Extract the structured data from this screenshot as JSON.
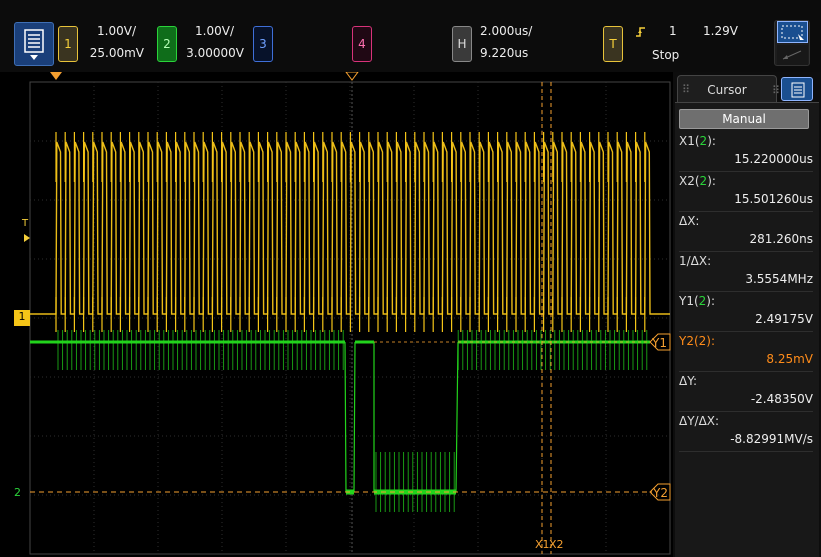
{
  "topbar": {
    "ch1": {
      "num": "1",
      "scale": "1.00V/",
      "offset": "25.00mV"
    },
    "ch2": {
      "num": "2",
      "scale": "1.00V/",
      "offset": "3.00000V"
    },
    "ch3": {
      "num": "3"
    },
    "ch4": {
      "num": "4"
    },
    "horizontal": {
      "label": "H",
      "scale": "2.000us/",
      "delay": "9.220us"
    },
    "trigger": {
      "label": "T",
      "channel": "1",
      "level": "1.29V",
      "status": "Stop"
    }
  },
  "scope": {
    "markers": {
      "trigger_T": "T",
      "ch1": "1",
      "ch2": "2",
      "y1": "Y1",
      "y2": "Y2",
      "x1": "X1",
      "x2": "X2"
    },
    "colors": {
      "ch1": "#f5c518",
      "ch2": "#22d41c",
      "cursor": "#f5a030",
      "grid": "#2e2e2e"
    }
  },
  "panel": {
    "tab_label": "Cursor",
    "mode": "Manual",
    "rows": [
      {
        "label": "X1(",
        "src": "2",
        "close": "):",
        "value": "15.220000us"
      },
      {
        "label": "X2(",
        "src": "2",
        "close": "):",
        "value": "15.501260us"
      },
      {
        "label": "ΔX:",
        "src": "",
        "close": "",
        "value": "281.260ns"
      },
      {
        "label": "1/ΔX:",
        "src": "",
        "close": "",
        "value": "3.5554MHz"
      },
      {
        "label": "Y1(",
        "src": "2",
        "close": "):",
        "value": "2.49175V"
      },
      {
        "label": "Y2(",
        "src": "2",
        "close": "):",
        "value": "8.25mV"
      },
      {
        "label": "ΔY:",
        "src": "",
        "close": "",
        "value": "-2.48350V"
      },
      {
        "label": "ΔY/ΔX:",
        "src": "",
        "close": "",
        "value": "-8.82991MV/s"
      }
    ]
  }
}
